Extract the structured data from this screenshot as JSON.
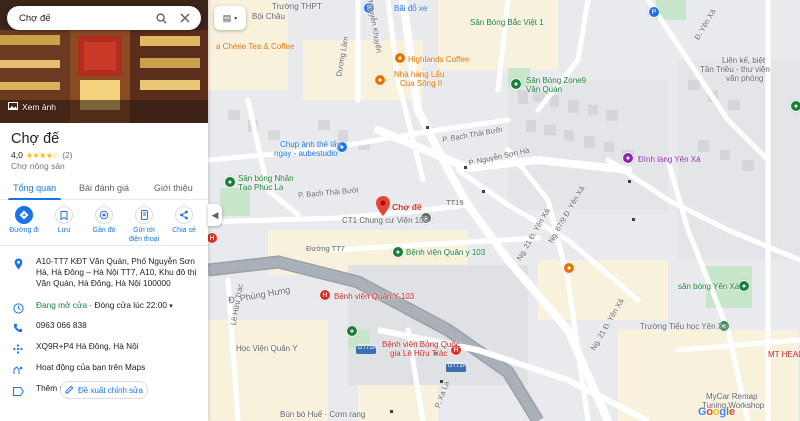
{
  "search": {
    "query": "Chợ đế"
  },
  "hero": {
    "photos_label": "Xem ảnh"
  },
  "place": {
    "name": "Chợ đế",
    "rating": "4,0",
    "stars": "★★★★☆",
    "review_count": "(2)",
    "category": "Chợ nông sản"
  },
  "tabs": [
    {
      "label": "Tổng quan"
    },
    {
      "label": "Bài đánh giá"
    },
    {
      "label": "Giới thiệu"
    }
  ],
  "actions": [
    {
      "label": "Đường đi",
      "icon": "directions-icon"
    },
    {
      "label": "Lưu",
      "icon": "bookmark-icon"
    },
    {
      "label": "Gần đó",
      "icon": "nearby-icon"
    },
    {
      "label": "Gửi tới điện thoại",
      "icon": "phone-send-icon"
    },
    {
      "label": "Chia sẻ",
      "icon": "share-icon"
    }
  ],
  "details": {
    "address": "A10-TT7 KĐT Văn Quán, Phố Nguyễn Sơn Hà, Hà Đông – Hà Nội TT7, A10, Khu đô thị Văn Quán, Hà Đông, Hà Nội 100000",
    "hours_status": "Đang mở cửa",
    "hours_detail": " · Đóng cửa lúc 22:00",
    "phone": "0963 066 838",
    "plus_code": "XQ9R+P4 Hà Đông, Hà Nội",
    "activity": "Hoạt động của bạn trên Maps",
    "label": "Thêm nhãn",
    "suggest_edit": "Đề xuất chỉnh sửa"
  },
  "map": {
    "main_pin_label": "Chợ đế",
    "labels": {
      "thpt": "Trường THPT",
      "boi_chau": "Bội Châu",
      "bai_do_xe": "Bãi đỗ xe",
      "san_bong_bac_viet": "Sân Bóng Bắc Việt 1",
      "cherie": "a Chérie Tea & Coffee",
      "highlands": "Highlands Coffee",
      "nha_hang_lau": "Nhà hàng Lẩu",
      "cua_song": "Cua Sông II",
      "san_bong_zone9": "Sân Bóng Zone9",
      "van_quan": "Văn Quán",
      "lien_ke": "Liên kế, biệt",
      "thu_vien": "Tân Triều - thư viện",
      "van_phong": "văn phòng",
      "chup_anh": "Chụp ảnh thẻ lấy",
      "ngay_studio": "ngay - aubestudio",
      "san_bong_nhan": "Sân bóng Nhân",
      "tao_phuc_la": "Tạo Phúc La",
      "dinh_lang": "Đình làng Yên Xá",
      "ct1": "CT1 Chung cư Viện 103",
      "benh_vien_quan_y": "Bệnh viện Quân y 103",
      "benh_vien_quan_y_red": "Bệnh viện Quân Y 103",
      "hoc_vien": "Học Viện Quân Y",
      "benh_vien_bong": "Bệnh viện Bỏng Quốc",
      "le_huu_trac": "gia Lê Hữu Trác",
      "san_bong_yen_xa": "sân bóng Yên Xá",
      "truong_tieu_hoc": "Trường Tiểu học Yên Xá",
      "mt_health": "MT HEALTH",
      "mycar": "MyCar Remap",
      "tuning": "Tuning Workshop",
      "bun_bo": "Bún bò Huế · Cơm rang",
      "phung_hung": "Đ. Phùng Hưng",
      "bach_thai_buoi": "P. Bạch Thái Bưởi",
      "bach_thai_buoi_2": "P. Bạch Thái Bưởi",
      "nguyen_son_ha": "P. Nguyễn Sơn Hà",
      "nguyen_khuyen": "Nguyễn Khuyến",
      "duong_tt7": "Đường TT7",
      "tt19": "TT19",
      "xa_la": "P. Xa La",
      "le_huu_trac_road": "Lê Hữu Trác",
      "yen_xa_1": "Ng. 21 Đ. Yên Xá",
      "yen_xa_2": "Ng. 21 Đ. Yên Xá",
      "yen_xa_3": "Ng. 67/9 Đ. Yên Xá",
      "yen_xa_4": "Đ. Yên Xá",
      "duong_lam": "Dương Lâm",
      "google": "Google",
      "d87a_1": "DT72A",
      "d87a_2": "DT72A"
    }
  },
  "colors": {
    "accent": "#1a73e8",
    "pin": "#ea4335",
    "open": "#188038",
    "stars": "#fbbc04"
  }
}
